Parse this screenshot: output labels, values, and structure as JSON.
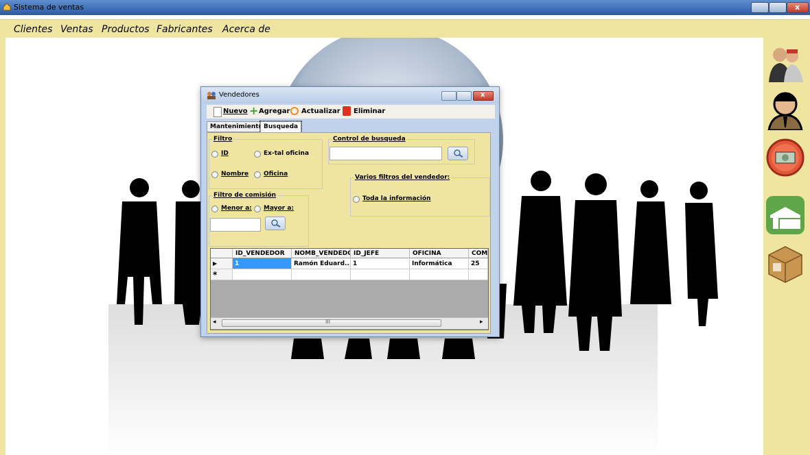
{
  "window": {
    "title": "Sistema de ventas"
  },
  "menu": {
    "items": [
      {
        "label": "Clientes"
      },
      {
        "label": "Ventas"
      },
      {
        "label": "Productos"
      },
      {
        "label": "Fabricantes"
      },
      {
        "label": "Acerca de"
      }
    ]
  },
  "sidebar": {
    "icons": [
      "people-icon",
      "seller-icon",
      "money-icon",
      "factory-icon",
      "box-icon"
    ]
  },
  "dialog": {
    "title": "Vendedores",
    "toolbar": {
      "nuevo": "Nuevo",
      "agregar": "Agregar",
      "actualizar": "Actualizar",
      "eliminar": "Eliminar"
    },
    "tabs": [
      {
        "label": "Mantenimiento"
      },
      {
        "label": "Busqueda"
      }
    ],
    "active_tab": "Busqueda",
    "filtro": {
      "legend": "Filtro",
      "options": {
        "id": "ID",
        "ex_tal": "Ex-tal oficina",
        "nombre": "Nombre",
        "oficina": "Oficina"
      }
    },
    "control": {
      "legend": "Control de busqueda",
      "value": ""
    },
    "varios": {
      "legend": "Varios filtros del vendedor:",
      "option": "Toda la información"
    },
    "comision": {
      "legend": "Filtro de comisión",
      "menor": "Menor a:",
      "mayor": "Mayor a:",
      "value": ""
    },
    "grid": {
      "columns": [
        "ID_VENDEDOR",
        "NOMB_VENDEDO",
        "ID_JEFE",
        "OFICINA",
        "COM"
      ],
      "rows": [
        {
          "cells": [
            "1",
            "Ramón Eduard...",
            "1",
            "Informática",
            "25"
          ]
        }
      ],
      "new_row_marker": "*",
      "current_row_marker": "▶",
      "scroll_label": "III"
    }
  }
}
